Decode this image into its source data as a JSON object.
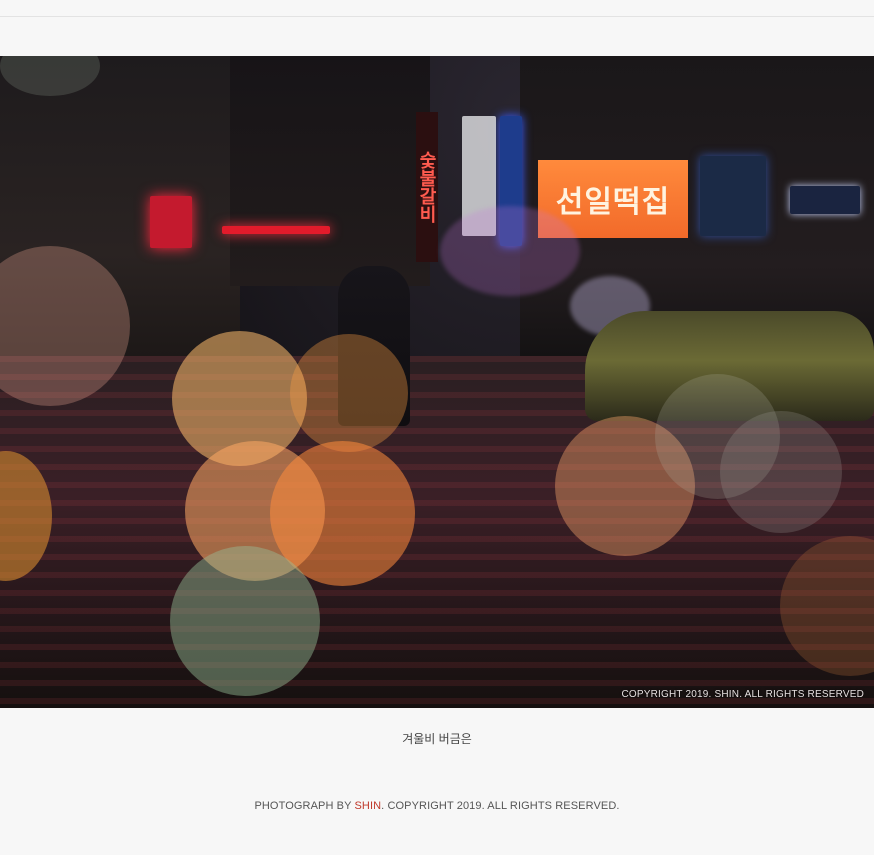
{
  "photo": {
    "alt_label": "rainy city street at night with bokeh lights",
    "shop_sign_text": "선일떡집",
    "neon_sign_text": "숯불갈비",
    "watermark": "COPYRIGHT 2019. SHIN. ALL RIGHTS RESERVED"
  },
  "caption": {
    "text": "겨울비 버금은"
  },
  "footer": {
    "prefix": "PHOTOGRAPH BY ",
    "author": "SHIN",
    "suffix": ". COPYRIGHT 2019. ALL RIGHTS RESERVED."
  },
  "colors": {
    "background": "#f7f7f7",
    "author_accent": "#c0392b",
    "caption_text": "#444444",
    "footer_text": "#555555"
  }
}
